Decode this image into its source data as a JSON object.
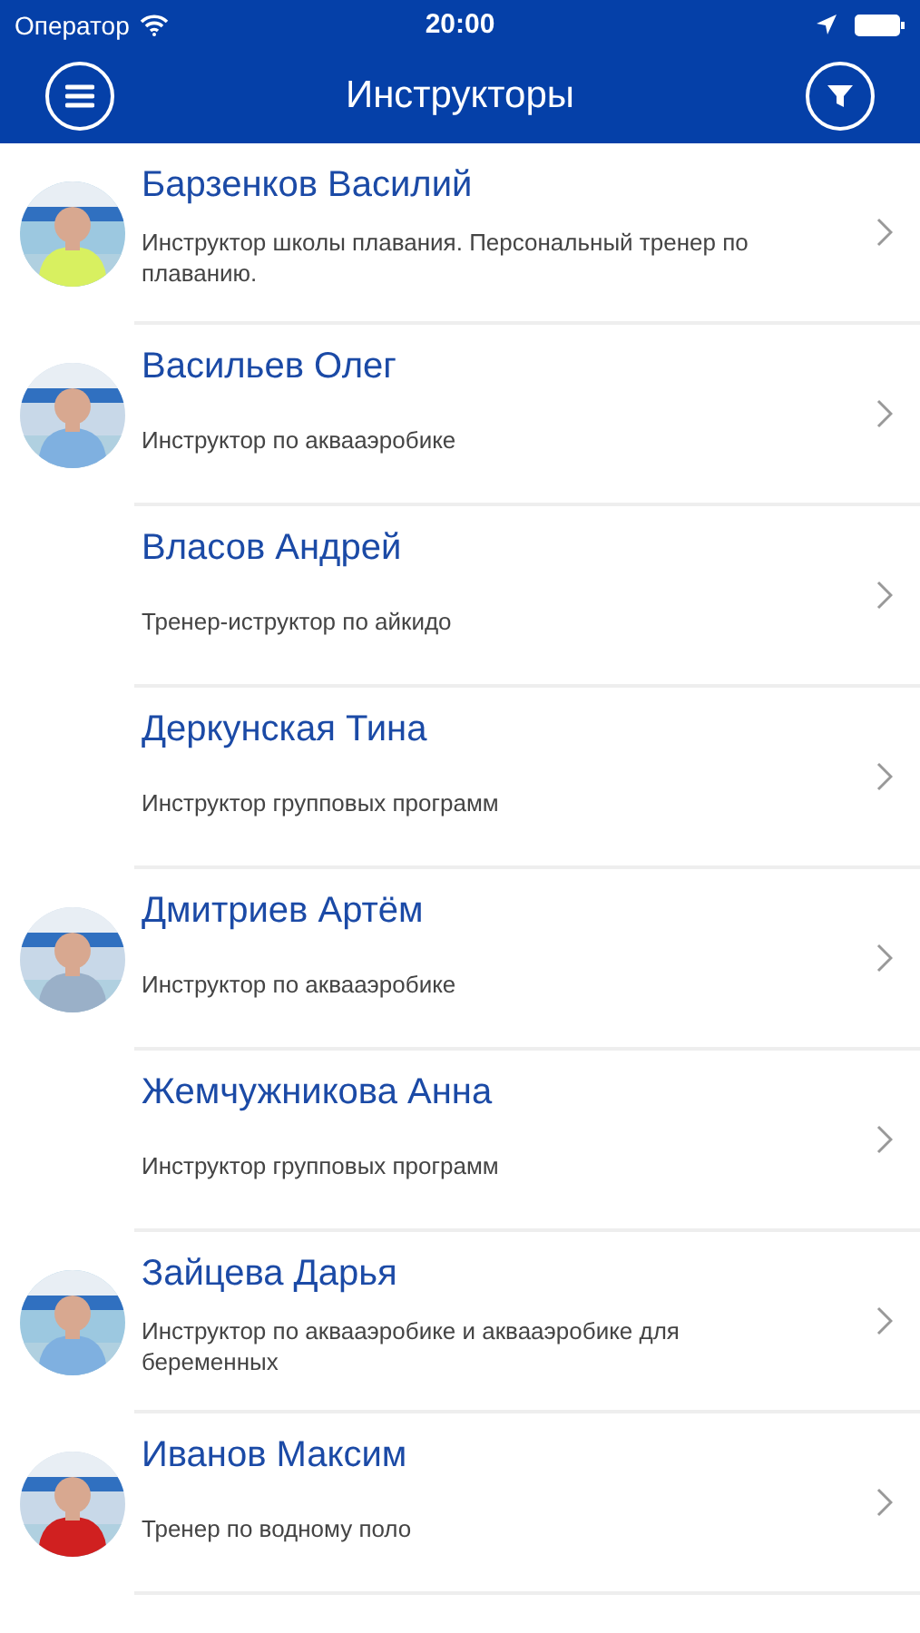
{
  "status_bar": {
    "carrier": "Оператор",
    "time": "20:00"
  },
  "nav": {
    "title": "Инструкторы"
  },
  "instructors": [
    {
      "name": "Барзенков Василий",
      "description": "Инструктор школы плавания. Персональный тренер по плаванию.",
      "photo": true
    },
    {
      "name": "Васильев Олег",
      "description": "Инструктор по аквааэробике",
      "photo": true
    },
    {
      "name": "Власов Андрей",
      "description": "Тренер-иструктор по айкидо",
      "photo": false
    },
    {
      "name": "Деркунская Тина",
      "description": "Инструктор групповых программ",
      "photo": false
    },
    {
      "name": "Дмитриев Артём",
      "description": "Инструктор по аквааэробике",
      "photo": true
    },
    {
      "name": "Жемчужникова Анна",
      "description": "Инструктор групповых программ",
      "photo": false
    },
    {
      "name": "Зайцева Дарья",
      "description": "Инструктор по аквааэробике и аквааэробике для беременных",
      "photo": true
    },
    {
      "name": "Иванов Максим",
      "description": "Тренер по водному поло",
      "photo": true
    }
  ]
}
